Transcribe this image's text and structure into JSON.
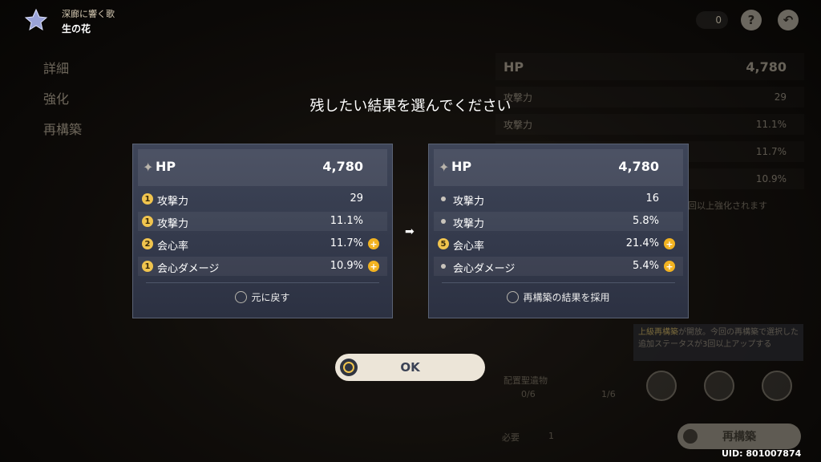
{
  "header": {
    "subtitle": "深廊に響く歌",
    "title": "生の花"
  },
  "topbar": {
    "count": "0",
    "help": "?",
    "back": "↶"
  },
  "nav": {
    "items": [
      "詳細",
      "強化",
      "再構築"
    ]
  },
  "dialog": {
    "title": "残したい結果を選んでください",
    "left": {
      "main_stat": {
        "name": "HP",
        "value": "4,780"
      },
      "substats": [
        {
          "badge": "1",
          "name": "攻撃力",
          "value": "29",
          "plus": false
        },
        {
          "badge": "1",
          "name": "攻撃力",
          "value": "11.1%",
          "plus": false
        },
        {
          "badge": "2",
          "name": "会心率",
          "value": "11.7%",
          "plus": true
        },
        {
          "badge": "1",
          "name": "会心ダメージ",
          "value": "10.9%",
          "plus": true
        }
      ],
      "choice": "元に戻す"
    },
    "right": {
      "main_stat": {
        "name": "HP",
        "value": "4,780"
      },
      "substats": [
        {
          "badge": "",
          "name": "攻撃力",
          "value": "16",
          "plus": false
        },
        {
          "badge": "",
          "name": "攻撃力",
          "value": "5.8%",
          "plus": false
        },
        {
          "badge": "5",
          "name": "会心率",
          "value": "21.4%",
          "plus": true
        },
        {
          "badge": "",
          "name": "会心ダメージ",
          "value": "5.4%",
          "plus": true
        }
      ],
      "choice": "再構築の結果を採用"
    },
    "ok_label": "OK"
  },
  "background": {
    "main": {
      "name": "HP",
      "value": "4,780"
    },
    "rows": [
      {
        "name": "攻撃力",
        "value": "29"
      },
      {
        "name": "攻撃力",
        "value": "11.1%"
      },
      {
        "name": "",
        "value": "11.7%"
      },
      {
        "name": "",
        "value": "10.9%"
      }
    ],
    "note": "で2回以上強化されます",
    "tip_highlight": "上級再構築",
    "tip_text": "が開放。今回の再構築で選択した追加ステータスが3回以上アップする",
    "material_label": "配置聖遺物",
    "counts": [
      "0/6",
      "1/6"
    ],
    "required_label": "必要",
    "required_value": "1",
    "rebuild_label": "再構築"
  },
  "uid": "UID: 801007874",
  "colors": {
    "accent_gold": "#f0c44e",
    "card_bg": "#353b4d",
    "ok_bg": "#ece5d8"
  },
  "icons": [
    "artifact-flower-icon",
    "star-icon",
    "arrow-right-icon",
    "radio-icon",
    "plus-icon",
    "help-icon",
    "back-icon"
  ]
}
